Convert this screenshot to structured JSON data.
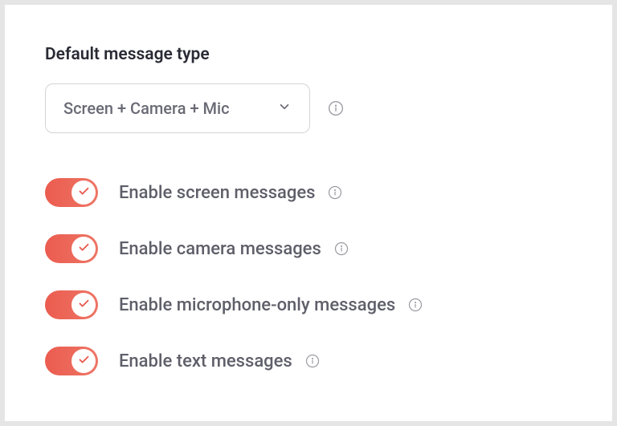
{
  "title": "Default message type",
  "select": {
    "value": "Screen + Camera + Mic"
  },
  "toggles": [
    {
      "label": "Enable screen messages",
      "on": true
    },
    {
      "label": "Enable camera messages",
      "on": true
    },
    {
      "label": "Enable microphone-only messages",
      "on": true
    },
    {
      "label": "Enable text messages",
      "on": true
    }
  ]
}
